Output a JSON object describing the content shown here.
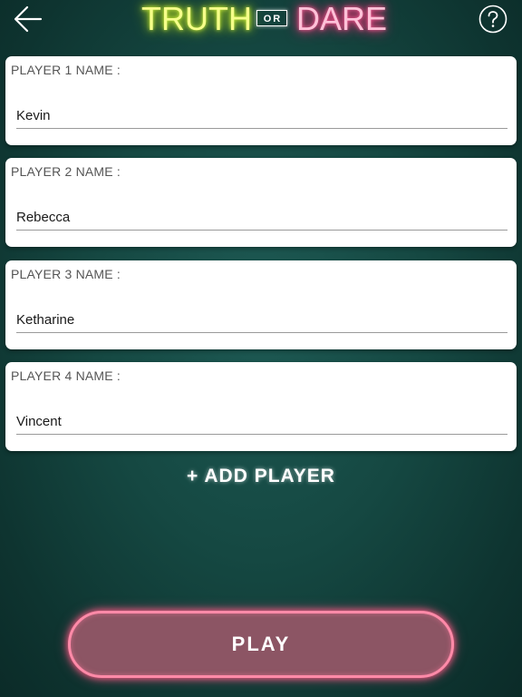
{
  "header": {
    "back_icon": "arrow-left-icon",
    "help_icon": "question-circle-icon",
    "logo": {
      "truth": "TRUTH",
      "or": "OR",
      "dare": "DARE"
    }
  },
  "players": [
    {
      "label": "PLAYER 1 NAME :",
      "value": "Kevin"
    },
    {
      "label": "PLAYER 2 NAME :",
      "value": "Rebecca"
    },
    {
      "label": "PLAYER 3 NAME :",
      "value": "Ketharine"
    },
    {
      "label": "PLAYER 4 NAME :",
      "value": "Vincent"
    }
  ],
  "add_player_label": "+ ADD PLAYER",
  "play_label": "PLAY",
  "colors": {
    "background": "#154842",
    "truth_neon": "#d6f53a",
    "dare_neon": "#ff3c80",
    "play_button_fill": "#8c5564",
    "play_button_border": "#ff8aa8"
  }
}
